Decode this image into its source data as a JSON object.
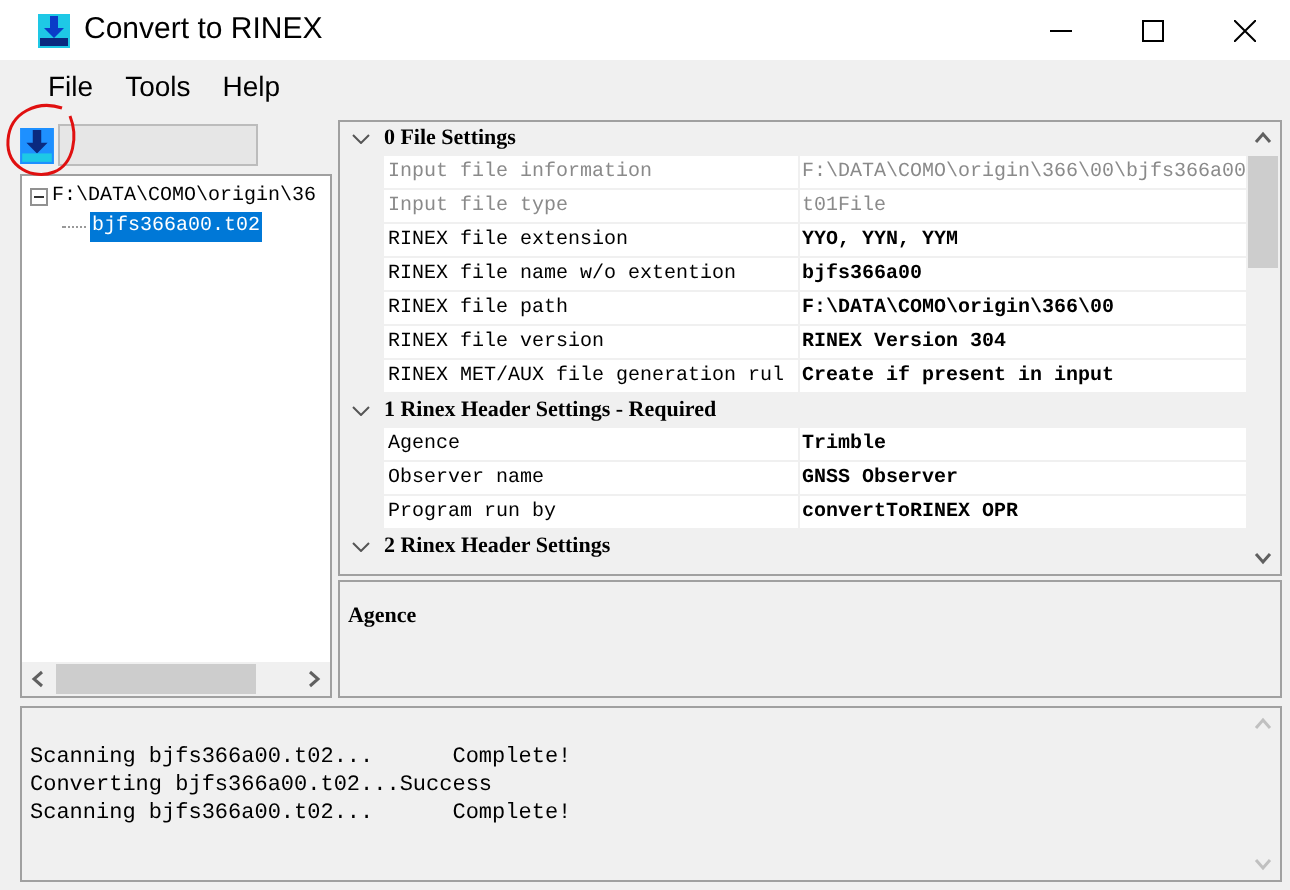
{
  "window": {
    "title": "Convert to RINEX"
  },
  "menu": [
    "File",
    "Tools",
    "Help"
  ],
  "progress": {
    "level": 0
  },
  "tree": [
    {
      "label": "F:\\DATA\\COMO\\origin\\36",
      "expanded": true,
      "selected": false,
      "children": [
        {
          "label": "bjfs366a00.t02",
          "selected": true
        }
      ]
    }
  ],
  "properties": [
    {
      "category": "0 File Settings",
      "expanded": true,
      "rows": [
        {
          "name": "Input file information",
          "value": "F:\\DATA\\COMO\\origin\\366\\00\\bjfs366a00",
          "readonly": true
        },
        {
          "name": "Input file type",
          "value": "t01File",
          "readonly": true
        },
        {
          "name": "RINEX file extension",
          "value": "YYO, YYN, YYM",
          "readonly": false
        },
        {
          "name": "RINEX file name w/o extention",
          "value": "bjfs366a00",
          "readonly": false
        },
        {
          "name": "RINEX file path",
          "value": "F:\\DATA\\COMO\\origin\\366\\00",
          "readonly": false
        },
        {
          "name": "RINEX file version",
          "value": "RINEX Version 304",
          "readonly": false
        },
        {
          "name": "RINEX MET/AUX file generation rul",
          "value": "Create if present in input",
          "readonly": false
        }
      ]
    },
    {
      "category": "1 Rinex Header Settings - Required",
      "expanded": true,
      "rows": [
        {
          "name": "Agence",
          "value": "Trimble",
          "readonly": false
        },
        {
          "name": "Observer name",
          "value": "GNSS Observer",
          "readonly": false
        },
        {
          "name": "Program run by",
          "value": "convertToRINEX OPR",
          "readonly": false
        }
      ]
    },
    {
      "category": "2 Rinex Header Settings",
      "expanded": true
    }
  ],
  "description": {
    "title": "Agence"
  },
  "log": [
    "Scanning bjfs366a00.t02...      Complete!",
    "Converting bjfs366a00.t02...Success",
    "Scanning bjfs366a00.t02...      Complete!"
  ]
}
